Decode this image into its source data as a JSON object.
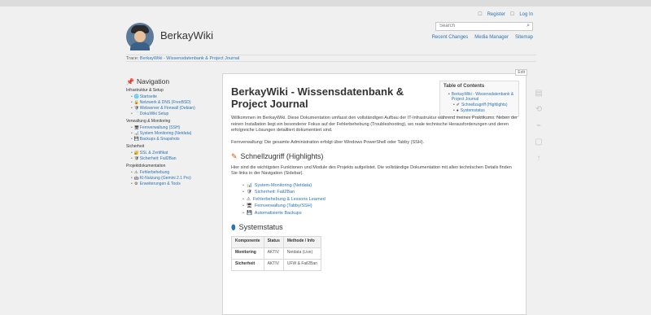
{
  "site": {
    "name": "BerkayWiki"
  },
  "header": {
    "userlinks": {
      "register": "Register",
      "login": "Log In"
    },
    "search": {
      "placeholder": "Search"
    },
    "tools": [
      "Recent Changes",
      "Media Manager",
      "Sitemap"
    ]
  },
  "breadcrumb": {
    "prefix": "Trace:",
    "items": [
      "BerkayWiki - Wissensdatenbank & Project Journal"
    ]
  },
  "sidebar": {
    "title": "Navigation",
    "sections": [
      {
        "title": "Infrastruktur & Setup",
        "items": [
          {
            "icon": "🌐",
            "label": "Startseite"
          },
          {
            "icon": "🔒",
            "label": "Netzwerk & DNS (FreeBSD)"
          },
          {
            "icon": "🛡",
            "label": "Webserver & Firewall (Debian)"
          },
          {
            "icon": "📄",
            "label": "DokuWiki Setup"
          }
        ]
      },
      {
        "title": "Verwaltung & Monitoring",
        "items": [
          {
            "icon": "🖥",
            "label": "Fernverwaltung (SSH)"
          },
          {
            "icon": "📊",
            "label": "System Monitoring (Netdata)"
          },
          {
            "icon": "💾",
            "label": "Backups & Snapshots"
          }
        ]
      },
      {
        "title": "Sicherheit",
        "items": [
          {
            "icon": "🔐",
            "label": "SSL & Zertifikat"
          },
          {
            "icon": "🛡",
            "label": "Sicherheit: Fail2Ban"
          }
        ]
      },
      {
        "title": "Projektdokumentation",
        "items": [
          {
            "icon": "⚠",
            "label": "Fehlerbehebung"
          },
          {
            "icon": "🤖",
            "label": "KI-Nutzung (Gemini 2.1 Pro)"
          },
          {
            "icon": "⚙",
            "label": "Erweiterungen & Tools"
          }
        ]
      }
    ]
  },
  "page": {
    "edit_label": "Edit",
    "title": "BerkayWiki - Wissensdatenbank & Project Journal",
    "intro": "Willkommen im BerkayWiki. Diese Dokumentation umfasst den vollständigen Aufbau der IT-Infrastruktur während meines Praktikums. Neben der reinen Installation liegt ein besonderer Fokus auf der Fehlerbehebung (Troubleshooting), wo reale technische Herausforderungen und deren erfolgreiche Lösungen detailliert dokumentiert sind.",
    "remote": "Fernverwaltung: Die gesamte Administration erfolgt über Windows PowerShell oder Tabby (SSH).",
    "highlights_title": "Schnellzugriff (Highlights)",
    "highlights_intro": "Hier sind die wichtigsten Funktionen und Module des Projekts aufgelistet. Die vollständige Dokumentation mit allen technischen Details finden Sie links in der Navigation (Sidebar).",
    "highlights": [
      {
        "icon": "📊",
        "label": "System-Monitoring (Netdata)"
      },
      {
        "icon": "🛡",
        "label": "Sicherheit: Fail2Ban"
      },
      {
        "icon": "⚠",
        "label": "Fehlerbehebung & Lessons Learned"
      },
      {
        "icon": "🖥",
        "label": "Fernverwaltung (Tabby/SSH)"
      },
      {
        "icon": "💾",
        "label": "Automatisierte Backups"
      }
    ],
    "status_title": "Systemstatus",
    "table": {
      "headers": [
        "Komponente",
        "Status",
        "Methode / Info"
      ],
      "rows": [
        [
          "Monitoring",
          "AKTIV",
          "Netdata (Live)"
        ],
        [
          "Sicherheit",
          "AKTIV",
          "UFW & Fail2Ban"
        ]
      ]
    }
  },
  "toc": {
    "title": "Table of Contents",
    "items": [
      {
        "level": 0,
        "label": "BerkayWiki - Wissensdatenbank & Project Journal"
      },
      {
        "level": 1,
        "label": "Schnellzugriff (Highlights)"
      },
      {
        "level": 1,
        "label": "Systemstatus"
      }
    ]
  },
  "colors": {
    "link": "#2b73b7",
    "background": "#f0f0f0",
    "page": "#ffffff"
  }
}
